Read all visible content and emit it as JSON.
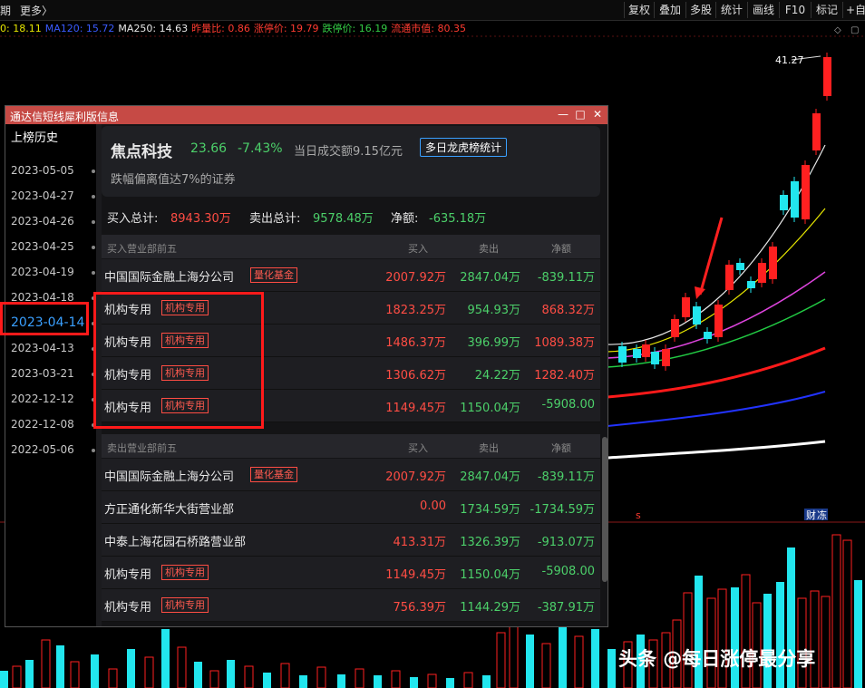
{
  "topbar": {
    "left": [
      "期",
      "更多〉"
    ],
    "buttons": [
      "复权",
      "叠加",
      "多股",
      "统计",
      "画线",
      "F10",
      "标记",
      "+自选"
    ]
  },
  "ma_row": [
    {
      "text": "0: 18.11",
      "color": "#e6e600"
    },
    {
      "text": "MA120: 15.72",
      "color": "#3a5bff"
    },
    {
      "text": "MA250: 14.63",
      "color": "#e8e8e8"
    },
    {
      "text": "昨量比: 0.86",
      "color": "#ff3b30"
    },
    {
      "text": "涨停价: 19.79",
      "color": "#ff3b30"
    },
    {
      "text": "跌停价: 16.19",
      "color": "#33cc44"
    },
    {
      "text": "流通市值: 80.35",
      "color": "#ff3b30"
    }
  ],
  "chart": {
    "max_label": "41.27",
    "markers": [
      "s",
      "财",
      "冻"
    ]
  },
  "popup": {
    "title": "通达信短线犀利版信息",
    "win_buttons": [
      "—",
      "□",
      "✕"
    ],
    "history_title": "上榜历史",
    "dates": [
      "2023-05-05",
      "2023-04-27",
      "2023-04-26",
      "2023-04-25",
      "2023-04-19",
      "2023-04-18",
      "2023-04-14",
      "2023-04-13",
      "2023-03-21",
      "2022-12-12",
      "2022-12-08",
      "2022-05-06"
    ],
    "selected_date": "2023-04-14",
    "stock": {
      "name": "焦点科技",
      "price": "23.66",
      "change": "-7.43%",
      "turnover": "当日成交额9.15亿元",
      "button": "多日龙虎榜统计",
      "reason": "跌幅偏离值达7%的证券"
    },
    "totals": {
      "buy_label": "买入总计:",
      "buy_value": "8943.30万",
      "sell_label": "卖出总计:",
      "sell_value": "9578.48万",
      "net_label": "净额:",
      "net_value": "-635.18万"
    },
    "buy_table": {
      "headers": [
        "买入营业部前五",
        "买入",
        "卖出",
        "净额"
      ],
      "rows": [
        {
          "name": "中国国际金融上海分公司",
          "tag": "量化基金",
          "buy": "2007.92万",
          "sell": "2847.04万",
          "net": "-839.11万",
          "net_sign": "neg"
        },
        {
          "name": "机构专用",
          "tag": "机构专用",
          "buy": "1823.25万",
          "sell": "954.93万",
          "net": "868.32万",
          "net_sign": "pos"
        },
        {
          "name": "机构专用",
          "tag": "机构专用",
          "buy": "1486.37万",
          "sell": "396.99万",
          "net": "1089.38万",
          "net_sign": "pos"
        },
        {
          "name": "机构专用",
          "tag": "机构专用",
          "buy": "1306.62万",
          "sell": "24.22万",
          "net": "1282.40万",
          "net_sign": "pos"
        },
        {
          "name": "机构专用",
          "tag": "机构专用",
          "buy": "1149.45万",
          "sell": "1150.04万",
          "net": "-5908.00",
          "net_sign": "neg"
        }
      ]
    },
    "sell_table": {
      "headers": [
        "卖出营业部前五",
        "买入",
        "卖出",
        "净额"
      ],
      "rows": [
        {
          "name": "中国国际金融上海分公司",
          "tag": "量化基金",
          "buy": "2007.92万",
          "sell": "2847.04万",
          "net": "-839.11万",
          "net_sign": "neg"
        },
        {
          "name": "方正通化新华大街营业部",
          "tag": "",
          "buy": "0.00",
          "sell": "1734.59万",
          "net": "-1734.59万",
          "net_sign": "neg"
        },
        {
          "name": "中泰上海花园石桥路营业部",
          "tag": "",
          "buy": "413.31万",
          "sell": "1326.39万",
          "net": "-913.07万",
          "net_sign": "neg"
        },
        {
          "name": "机构专用",
          "tag": "机构专用",
          "buy": "1149.45万",
          "sell": "1150.04万",
          "net": "-5908.00",
          "net_sign": "neg"
        },
        {
          "name": "机构专用",
          "tag": "机构专用",
          "buy": "756.39万",
          "sell": "1144.29万",
          "net": "-387.91万",
          "net_sign": "neg"
        }
      ]
    }
  },
  "watermark": "头条 @每日涨停最分享"
}
